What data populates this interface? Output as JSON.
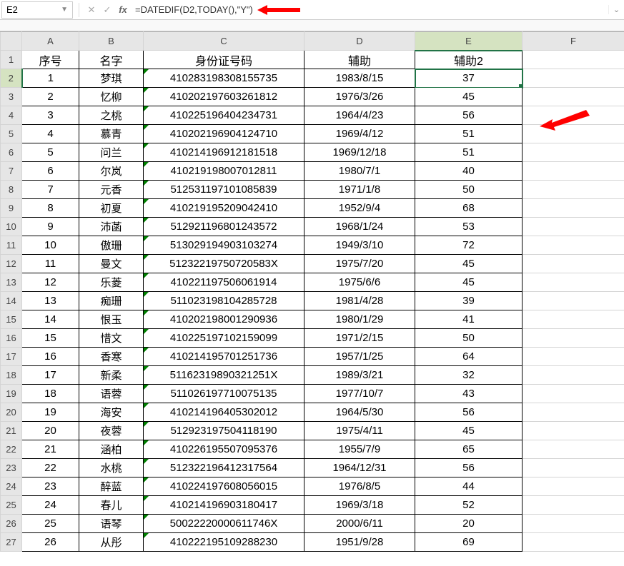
{
  "nameBox": "E2",
  "formula": "=DATEDIF(D2,TODAY(),\"Y\")",
  "columns": [
    "A",
    "B",
    "C",
    "D",
    "E",
    "F"
  ],
  "headerRow": {
    "a": "序号",
    "b": "名字",
    "c": "身份证号码",
    "d": "辅助",
    "e": "辅助2"
  },
  "rows": [
    {
      "n": "1",
      "a": "1",
      "b": "梦琪",
      "c": "410283198308155735",
      "d": "1983/8/15",
      "e": "37"
    },
    {
      "n": "2",
      "a": "2",
      "b": "忆柳",
      "c": "410202197603261812",
      "d": "1976/3/26",
      "e": "45"
    },
    {
      "n": "3",
      "a": "3",
      "b": "之桃",
      "c": "410225196404234731",
      "d": "1964/4/23",
      "e": "56"
    },
    {
      "n": "4",
      "a": "4",
      "b": "慕青",
      "c": "410202196904124710",
      "d": "1969/4/12",
      "e": "51"
    },
    {
      "n": "5",
      "a": "5",
      "b": "问兰",
      "c": "410214196912181518",
      "d": "1969/12/18",
      "e": "51"
    },
    {
      "n": "6",
      "a": "6",
      "b": "尔岚",
      "c": "410219198007012811",
      "d": "1980/7/1",
      "e": "40"
    },
    {
      "n": "7",
      "a": "7",
      "b": "元香",
      "c": "512531197101085839",
      "d": "1971/1/8",
      "e": "50"
    },
    {
      "n": "8",
      "a": "8",
      "b": "初夏",
      "c": "410219195209042410",
      "d": "1952/9/4",
      "e": "68"
    },
    {
      "n": "9",
      "a": "9",
      "b": "沛菡",
      "c": "512921196801243572",
      "d": "1968/1/24",
      "e": "53"
    },
    {
      "n": "10",
      "a": "10",
      "b": "傲珊",
      "c": "513029194903103274",
      "d": "1949/3/10",
      "e": "72"
    },
    {
      "n": "11",
      "a": "11",
      "b": "曼文",
      "c": "51232219750720583X",
      "d": "1975/7/20",
      "e": "45"
    },
    {
      "n": "12",
      "a": "12",
      "b": "乐菱",
      "c": "410221197506061914",
      "d": "1975/6/6",
      "e": "45"
    },
    {
      "n": "13",
      "a": "13",
      "b": "痴珊",
      "c": "511023198104285728",
      "d": "1981/4/28",
      "e": "39"
    },
    {
      "n": "14",
      "a": "14",
      "b": "恨玉",
      "c": "410202198001290936",
      "d": "1980/1/29",
      "e": "41"
    },
    {
      "n": "15",
      "a": "15",
      "b": "惜文",
      "c": "410225197102159099",
      "d": "1971/2/15",
      "e": "50"
    },
    {
      "n": "16",
      "a": "16",
      "b": "香寒",
      "c": "410214195701251736",
      "d": "1957/1/25",
      "e": "64"
    },
    {
      "n": "17",
      "a": "17",
      "b": "新柔",
      "c": "51162319890321251X",
      "d": "1989/3/21",
      "e": "32"
    },
    {
      "n": "18",
      "a": "18",
      "b": "语蓉",
      "c": "511026197710075135",
      "d": "1977/10/7",
      "e": "43"
    },
    {
      "n": "19",
      "a": "19",
      "b": "海安",
      "c": "410214196405302012",
      "d": "1964/5/30",
      "e": "56"
    },
    {
      "n": "20",
      "a": "20",
      "b": "夜蓉",
      "c": "512923197504118190",
      "d": "1975/4/11",
      "e": "45"
    },
    {
      "n": "21",
      "a": "21",
      "b": "涵柏",
      "c": "410226195507095376",
      "d": "1955/7/9",
      "e": "65"
    },
    {
      "n": "22",
      "a": "22",
      "b": "水桃",
      "c": "512322196412317564",
      "d": "1964/12/31",
      "e": "56"
    },
    {
      "n": "23",
      "a": "23",
      "b": "醉蓝",
      "c": "410224197608056015",
      "d": "1976/8/5",
      "e": "44"
    },
    {
      "n": "24",
      "a": "24",
      "b": "春儿",
      "c": "410214196903180417",
      "d": "1969/3/18",
      "e": "52"
    },
    {
      "n": "25",
      "a": "25",
      "b": "语琴",
      "c": "50022220000611746X",
      "d": "2000/6/11",
      "e": "20"
    },
    {
      "n": "26",
      "a": "26",
      "b": "从彤",
      "c": "410222195109288230",
      "d": "1951/9/28",
      "e": "69"
    }
  ]
}
